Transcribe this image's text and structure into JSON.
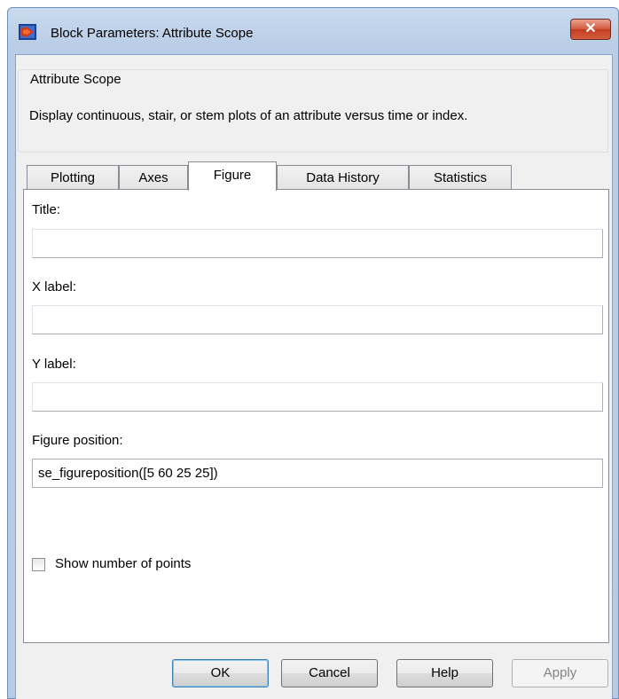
{
  "window": {
    "title": "Block Parameters: Attribute Scope",
    "close_glyph": "✕",
    "icon": "simulink-block-icon"
  },
  "group": {
    "legend": "Attribute Scope",
    "description": "Display continuous, stair, or stem plots of an attribute versus time or index."
  },
  "tabs": [
    {
      "label": "Plotting",
      "active": false
    },
    {
      "label": "Axes",
      "active": false
    },
    {
      "label": "Figure",
      "active": true
    },
    {
      "label": "Data History",
      "active": false
    },
    {
      "label": "Statistics",
      "active": false
    }
  ],
  "figure_tab": {
    "title_label": "Title:",
    "title_value": "",
    "xlabel_label": "X label:",
    "xlabel_value": "",
    "ylabel_label": "Y label:",
    "ylabel_value": "",
    "position_label": "Figure position:",
    "position_value": "se_figureposition([5 60 25 25])",
    "show_points_label": "Show number of points",
    "show_points_checked": false
  },
  "buttons": {
    "ok": "OK",
    "cancel": "Cancel",
    "help": "Help",
    "apply": "Apply"
  }
}
